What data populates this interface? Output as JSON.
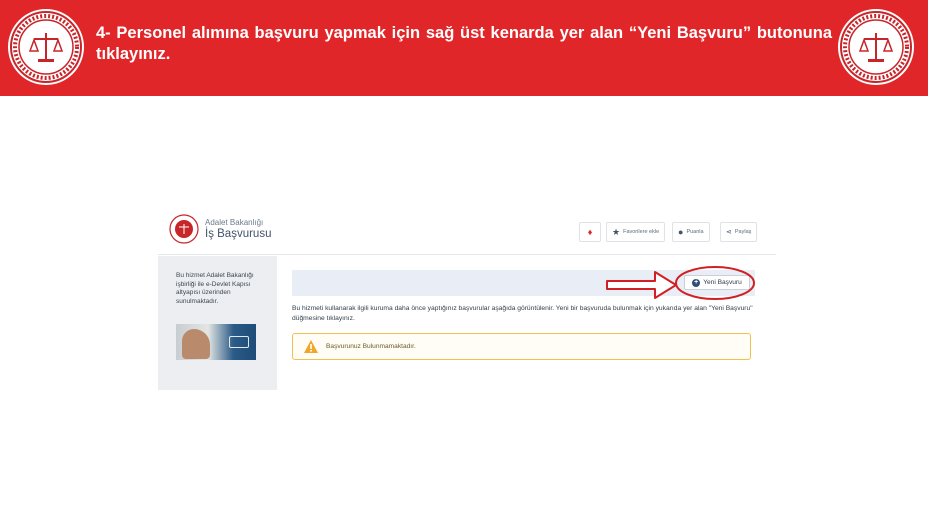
{
  "banner": {
    "instruction": "4- Personel alımına başvuru yapmak için sağ üst kenarda yer alan “Yeni Başvuru” butonuna tıklayınız.",
    "color": "#e1262a"
  },
  "header": {
    "brand_top": "Adalet Bakanlığı",
    "brand_main": "İş Başvurusu",
    "buttons": {
      "home_icon": "fire-home-icon",
      "favorites": "Favorilere ekle",
      "rate": "Puanla",
      "share": "Paylaş"
    }
  },
  "sidebar": {
    "text": "Bu hizmet Adalet Bakanlığı işbirliği ile e-Devlet Kapısı altyapısı üzerinden sunulmaktadır."
  },
  "main": {
    "new_application": "Yeni Başvuru",
    "info": "Bu hizmeti kullanarak ilgili kuruma daha önce yaptığınız başvurular aşağıda görüntülenir. Yeni bir başvuruda bulunmak için yukarıda yer alan \"Yeni Başvuru\" düğmesine tıklayınız.",
    "alert": "Başvurunuz Bulunmamaktadır."
  },
  "annotation": {
    "color": "#d11f24"
  }
}
